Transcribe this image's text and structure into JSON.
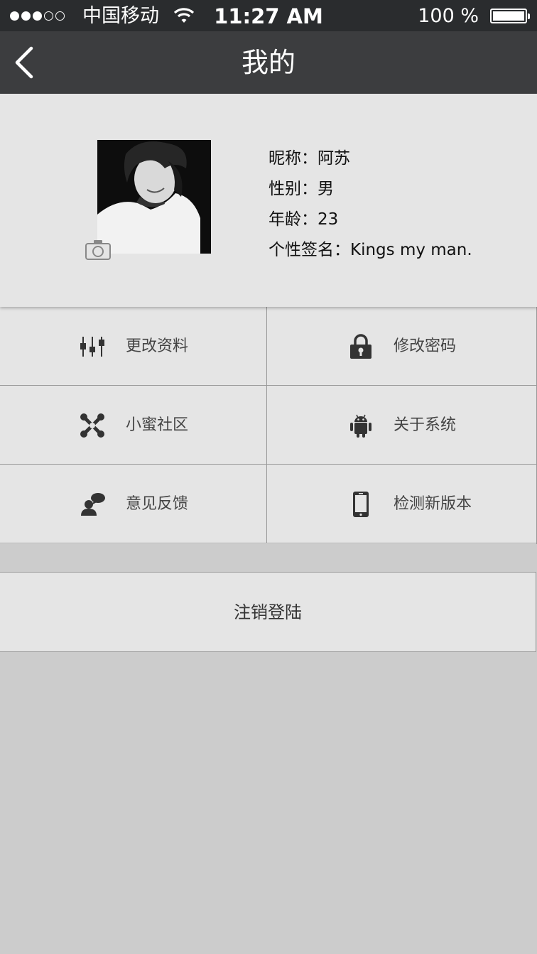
{
  "status_bar": {
    "carrier": "中国移动",
    "time": "11:27 AM",
    "battery": "100 %",
    "signal_icon": "signal-dots-icon",
    "wifi_icon": "wifi-icon",
    "battery_icon": "battery-icon"
  },
  "navbar": {
    "title": "我的",
    "back_icon": "chevron-left-icon"
  },
  "profile": {
    "nickname": "昵称：阿苏",
    "gender": "性别：男",
    "age": "年龄：23",
    "signature": "个性签名：Kings my man.",
    "avatar_icon": "avatar-photo",
    "camera_icon": "camera-icon"
  },
  "menu": {
    "edit_profile": "更改资料",
    "change_password": "修改密码",
    "community": "小蜜社区",
    "about": "关于系统",
    "feedback": "意见反馈",
    "check_update": "检测新版本"
  },
  "logout": "注销登陆"
}
